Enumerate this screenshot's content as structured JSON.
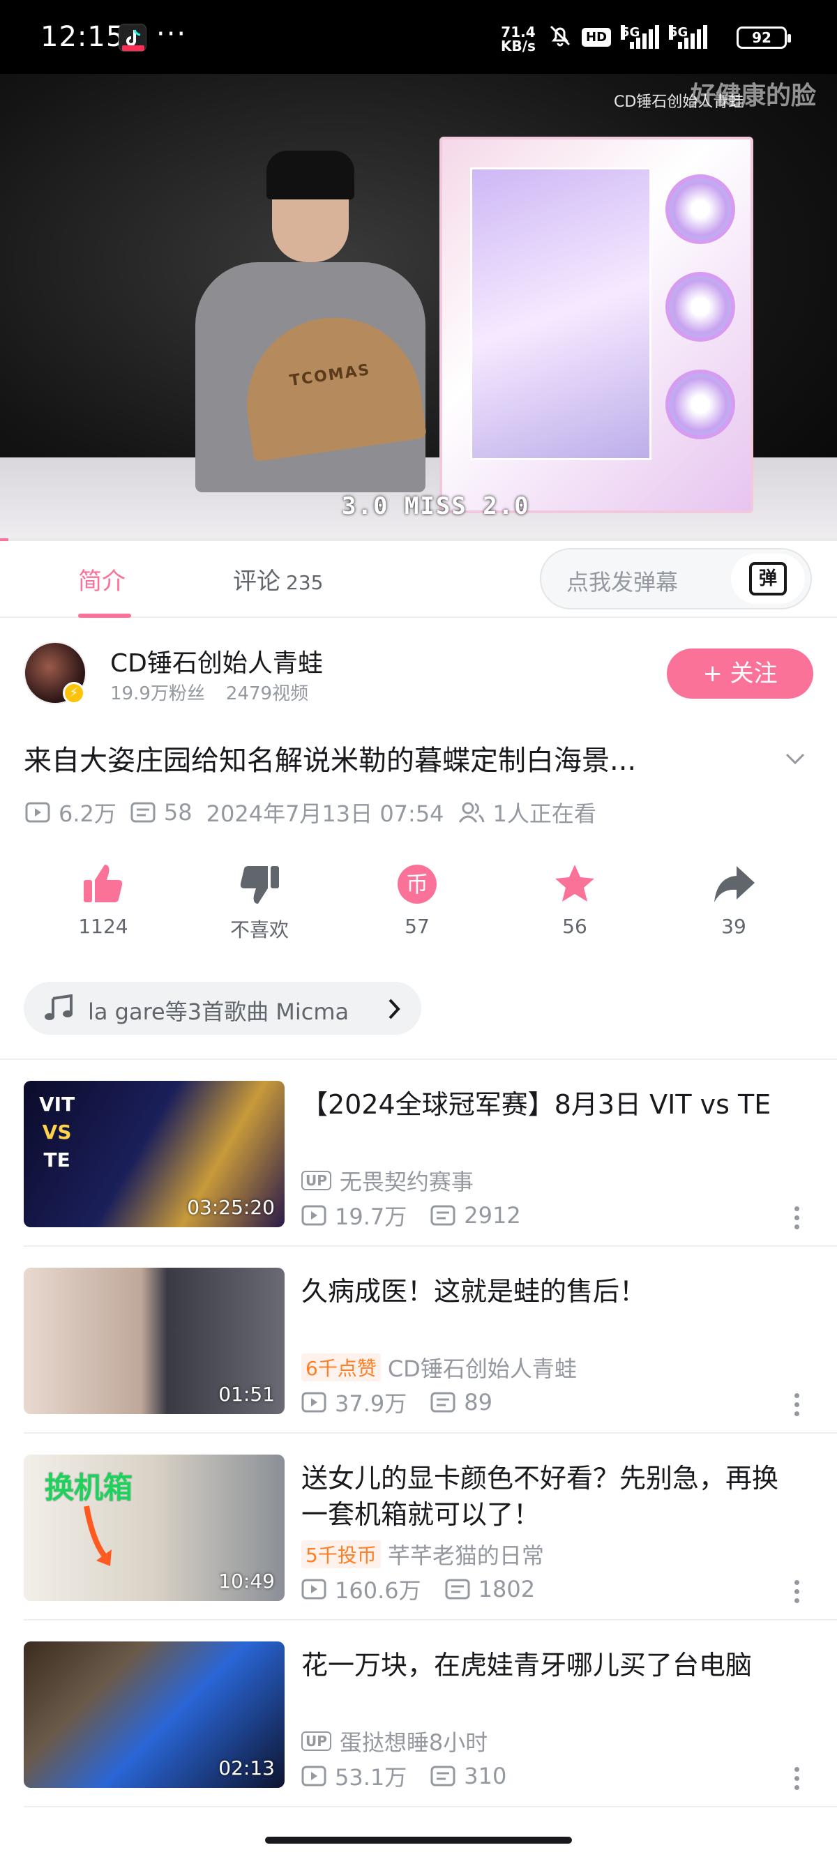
{
  "status_bar": {
    "time": "12:15",
    "more": "···",
    "speed_value": "71.4",
    "speed_unit": "KB/s",
    "hd_label": "HD",
    "network_1": "5G",
    "network_2": "5G",
    "battery": "92"
  },
  "player": {
    "uploader_mark": "CD锤石创始人青蛙",
    "watermark": "好健康的脸",
    "caption": "3.0 MISS 2.0",
    "fan_text": "TCOMAS",
    "progress": 0.01,
    "accent_color": "#fb7299"
  },
  "tabs": {
    "intro": "简介",
    "comments": "评论",
    "comments_count": "235",
    "danmaku_placeholder": "点我发弹幕",
    "danmaku_icon": "弹"
  },
  "uploader": {
    "name": "CD锤石创始人青蛙",
    "fans": "19.9万粉丝",
    "videos": "2479视频",
    "follow_label": "+ 关注"
  },
  "video": {
    "title": "来自大姿庄园给知名解说米勒的暮蝶定制白海景...",
    "views": "6.2万",
    "danmaku_count": "58",
    "date": "2024年7月13日 07:54",
    "watching": "1人正在看"
  },
  "actions": {
    "like": "1124",
    "dislike": "不喜欢",
    "coin": "57",
    "favorite": "56",
    "share": "39"
  },
  "music": {
    "text": "la gare等3首歌曲   Micma"
  },
  "recommendations": [
    {
      "title": "【2024全球冠军赛】8月3日 VIT vs TE",
      "badge_type": "up",
      "badge": "UP",
      "author": "无畏契约赛事",
      "views": "19.7万",
      "danmaku": "2912",
      "duration": "03:25:20",
      "thumb_text_1": "VIT",
      "thumb_text_2": "VS",
      "thumb_text_3": "TE"
    },
    {
      "title": "久病成医！这就是蛙的售后！",
      "badge_type": "hot",
      "badge": "6千点赞",
      "author": "CD锤石创始人青蛙",
      "views": "37.9万",
      "danmaku": "89",
      "duration": "01:51"
    },
    {
      "title": "送女儿的显卡颜色不好看？先别急，再换一套机箱就可以了！",
      "badge_type": "hot",
      "badge": "5千投币",
      "author": "芊芊老猫的日常",
      "views": "160.6万",
      "danmaku": "1802",
      "duration": "10:49",
      "thumb_text_1": "换机箱"
    },
    {
      "title": "花一万块，在虎娃青牙哪儿买了台电脑",
      "badge_type": "up",
      "badge": "UP",
      "author": "蛋挞想睡8小时",
      "views": "53.1万",
      "danmaku": "310",
      "duration": "02:13"
    }
  ]
}
